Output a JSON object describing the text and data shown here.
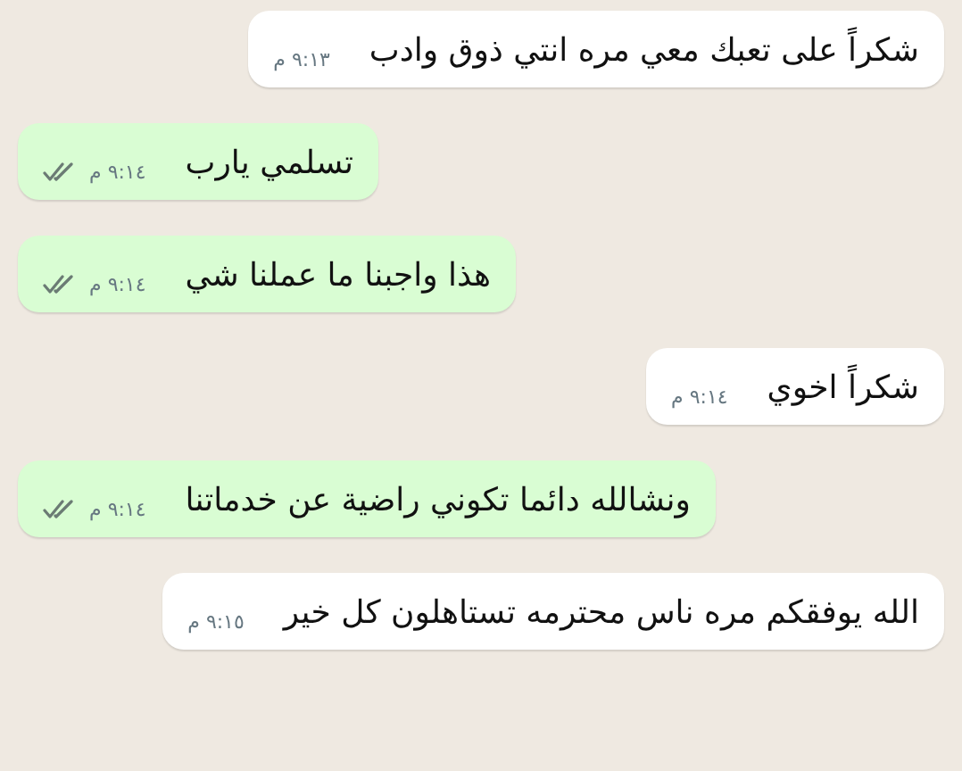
{
  "messages": [
    {
      "kind": "incoming",
      "text": "شكراً على تعبك معي مره انتي ذوق وادب",
      "time": "٩:١٣ م"
    },
    {
      "kind": "outgoing",
      "text": "تسلمي يارب",
      "time": "٩:١٤ م"
    },
    {
      "kind": "outgoing",
      "text": "هذا واجبنا ما عملنا شي",
      "time": "٩:١٤ م"
    },
    {
      "kind": "incoming",
      "text": "شكراً اخوي",
      "time": "٩:١٤ م"
    },
    {
      "kind": "outgoing",
      "text": "ونشالله دائما تكوني راضية عن خدماتنا",
      "time": "٩:١٤ م"
    },
    {
      "kind": "incoming",
      "text": "الله يوفقكم مره ناس محترمه تستاهلون كل خير",
      "time": "٩:١٥ م"
    }
  ]
}
